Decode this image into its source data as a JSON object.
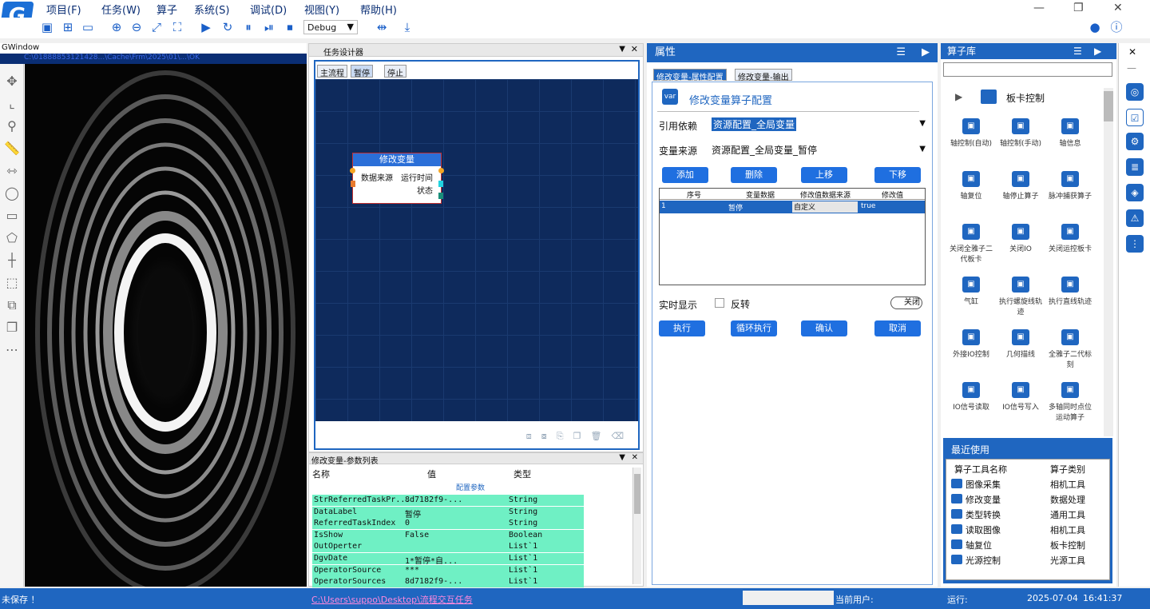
{
  "app": {
    "logo": "G"
  },
  "menu": [
    "项目(F)",
    "任务(W)",
    "算子",
    "系统(S)",
    "调试(D)",
    "视图(Y)",
    "帮助(H)"
  ],
  "toolbar": {
    "mode": "Debug"
  },
  "left_window": {
    "title": "GWindow",
    "path": "C:\\01888853121428...\\Cache\\Frm\\2025\\01\\...\\OK"
  },
  "task": {
    "title": "任务设计器",
    "tabs": [
      "主流程",
      "暂停",
      "停止"
    ],
    "node": {
      "title": "修改变量",
      "in": "数据来源",
      "out1": "运行时间",
      "out2": "状态"
    }
  },
  "params": {
    "title": "修改变量-参数列表",
    "cols": [
      "名称",
      "值",
      "类型"
    ],
    "group": "配置参数",
    "rows": [
      [
        "StrReferredTaskPr...",
        "8d7182f9-...",
        "String"
      ],
      [
        "DataLabel",
        "暂停",
        "String"
      ],
      [
        "ReferredTaskIndex",
        "0",
        "String"
      ],
      [
        "IsShow",
        "False",
        "Boolean"
      ],
      [
        "OutOperter",
        "",
        "List`1"
      ],
      [
        "DgvDate",
        "1*暂停*自...",
        "List`1"
      ],
      [
        "OperatorSource",
        "***",
        "List`1"
      ],
      [
        "OperatorSources",
        "8d7182f9-...",
        "List`1"
      ]
    ]
  },
  "props": {
    "title": "属性",
    "tabs": [
      "修改变量-属性配置",
      "修改变量-输出"
    ],
    "header": "修改变量算子配置",
    "ref_label": "引用依赖",
    "ref_value": "资源配置_全局变量",
    "src_label": "变量来源",
    "src_value": "资源配置_全局变量_暂停",
    "buttons": [
      "添加",
      "删除",
      "上移",
      "下移"
    ],
    "table_cols": [
      "序号",
      "变量数据",
      "修改值数据来源",
      "修改值"
    ],
    "table_row": [
      "1",
      "暂停",
      "自定义",
      "true"
    ],
    "realtime": "实时显示",
    "invert": "反转",
    "toggle": "关闭",
    "actions": [
      "执行",
      "循环执行",
      "确认",
      "取消"
    ]
  },
  "lib": {
    "title": "算子库",
    "category": "板卡控制",
    "items": [
      "轴控制(自动)",
      "轴控制(手动)",
      "轴信息",
      "轴复位",
      "轴停止算子",
      "脉冲捕获算子",
      "关闭全雅子二代板卡",
      "关闭IO",
      "关闭运控板卡",
      "气缸",
      "执行螺旋线轨迹",
      "执行直线轨迹",
      "外接IO控制",
      "几何描线",
      "全雅子二代标刻",
      "IO信号读取",
      "IO信号写入",
      "多轴同时点位运动算子"
    ],
    "recent_title": "最近使用",
    "recent_cols": [
      "算子工具名称",
      "算子类别"
    ],
    "recent": [
      [
        "图像采集",
        "相机工具"
      ],
      [
        "修改变量",
        "数据处理"
      ],
      [
        "类型转换",
        "通用工具"
      ],
      [
        "读取图像",
        "相机工具"
      ],
      [
        "轴复位",
        "板卡控制"
      ],
      [
        "光源控制",
        "光源工具"
      ]
    ]
  },
  "status": {
    "saved": "未保存 ！",
    "path": "C:\\Users\\suppo\\Desktop\\流程交互任务",
    "user": "当前用户:",
    "run": "运行:",
    "date": "2025-07-04",
    "time": "16:41:37"
  }
}
